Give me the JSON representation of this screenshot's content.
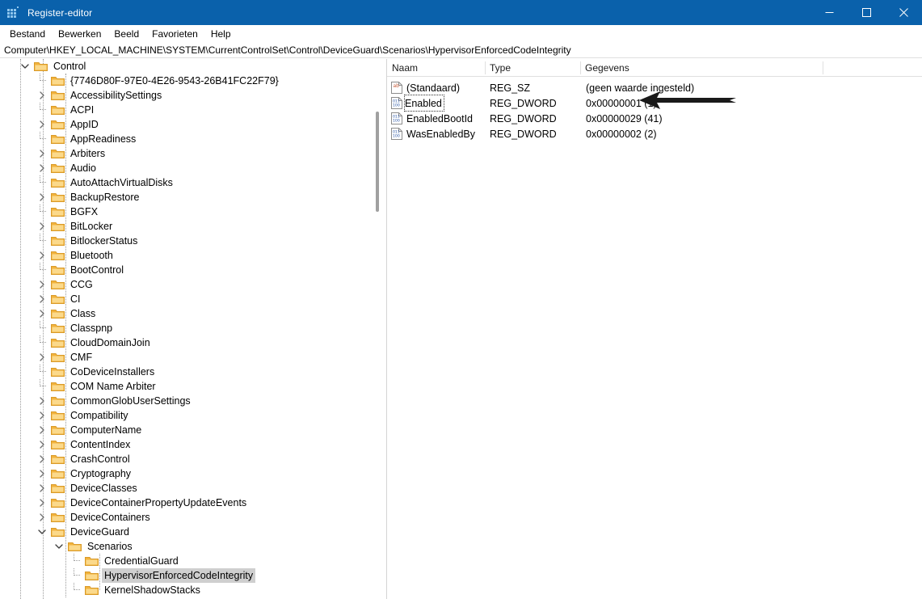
{
  "window": {
    "title": "Register-editor",
    "icon": "regedit-icon",
    "minimize_label": "─",
    "maximize_label": "□",
    "close_label": "✕"
  },
  "menubar": {
    "items": [
      {
        "label": "Bestand",
        "name": "menu-bestand"
      },
      {
        "label": "Bewerken",
        "name": "menu-bewerken"
      },
      {
        "label": "Beeld",
        "name": "menu-beeld"
      },
      {
        "label": "Favorieten",
        "name": "menu-favorieten"
      },
      {
        "label": "Help",
        "name": "menu-help"
      }
    ]
  },
  "address": {
    "path": "Computer\\HKEY_LOCAL_MACHINE\\SYSTEM\\CurrentControlSet\\Control\\DeviceGuard\\Scenarios\\HypervisorEnforcedCodeIntegrity"
  },
  "tree": {
    "nodes": [
      {
        "label": "Control",
        "depth": 2,
        "state": "expanded",
        "selected": false
      },
      {
        "label": "{7746D80F-97E0-4E26-9543-26B41FC22F79}",
        "depth": 3,
        "state": "leaf",
        "selected": false
      },
      {
        "label": "AccessibilitySettings",
        "depth": 3,
        "state": "collapsed",
        "selected": false
      },
      {
        "label": "ACPI",
        "depth": 3,
        "state": "leaf",
        "selected": false
      },
      {
        "label": "AppID",
        "depth": 3,
        "state": "collapsed",
        "selected": false
      },
      {
        "label": "AppReadiness",
        "depth": 3,
        "state": "leaf",
        "selected": false
      },
      {
        "label": "Arbiters",
        "depth": 3,
        "state": "collapsed",
        "selected": false
      },
      {
        "label": "Audio",
        "depth": 3,
        "state": "collapsed",
        "selected": false
      },
      {
        "label": "AutoAttachVirtualDisks",
        "depth": 3,
        "state": "leaf",
        "selected": false
      },
      {
        "label": "BackupRestore",
        "depth": 3,
        "state": "collapsed",
        "selected": false
      },
      {
        "label": "BGFX",
        "depth": 3,
        "state": "leaf",
        "selected": false
      },
      {
        "label": "BitLocker",
        "depth": 3,
        "state": "collapsed",
        "selected": false
      },
      {
        "label": "BitlockerStatus",
        "depth": 3,
        "state": "leaf",
        "selected": false
      },
      {
        "label": "Bluetooth",
        "depth": 3,
        "state": "collapsed",
        "selected": false
      },
      {
        "label": "BootControl",
        "depth": 3,
        "state": "leaf",
        "selected": false
      },
      {
        "label": "CCG",
        "depth": 3,
        "state": "collapsed",
        "selected": false
      },
      {
        "label": "CI",
        "depth": 3,
        "state": "collapsed",
        "selected": false
      },
      {
        "label": "Class",
        "depth": 3,
        "state": "collapsed",
        "selected": false
      },
      {
        "label": "Classpnp",
        "depth": 3,
        "state": "leaf",
        "selected": false
      },
      {
        "label": "CloudDomainJoin",
        "depth": 3,
        "state": "leaf",
        "selected": false
      },
      {
        "label": "CMF",
        "depth": 3,
        "state": "collapsed",
        "selected": false
      },
      {
        "label": "CoDeviceInstallers",
        "depth": 3,
        "state": "leaf",
        "selected": false
      },
      {
        "label": "COM Name Arbiter",
        "depth": 3,
        "state": "leaf",
        "selected": false
      },
      {
        "label": "CommonGlobUserSettings",
        "depth": 3,
        "state": "collapsed",
        "selected": false
      },
      {
        "label": "Compatibility",
        "depth": 3,
        "state": "collapsed",
        "selected": false
      },
      {
        "label": "ComputerName",
        "depth": 3,
        "state": "collapsed",
        "selected": false
      },
      {
        "label": "ContentIndex",
        "depth": 3,
        "state": "collapsed",
        "selected": false
      },
      {
        "label": "CrashControl",
        "depth": 3,
        "state": "collapsed",
        "selected": false
      },
      {
        "label": "Cryptography",
        "depth": 3,
        "state": "collapsed",
        "selected": false
      },
      {
        "label": "DeviceClasses",
        "depth": 3,
        "state": "collapsed",
        "selected": false
      },
      {
        "label": "DeviceContainerPropertyUpdateEvents",
        "depth": 3,
        "state": "collapsed",
        "selected": false
      },
      {
        "label": "DeviceContainers",
        "depth": 3,
        "state": "collapsed",
        "selected": false
      },
      {
        "label": "DeviceGuard",
        "depth": 3,
        "state": "expanded",
        "selected": false
      },
      {
        "label": "Scenarios",
        "depth": 4,
        "state": "expanded",
        "selected": false
      },
      {
        "label": "CredentialGuard",
        "depth": 5,
        "state": "leaf",
        "selected": false
      },
      {
        "label": "HypervisorEnforcedCodeIntegrity",
        "depth": 5,
        "state": "leaf",
        "selected": true
      },
      {
        "label": "KernelShadowStacks",
        "depth": 5,
        "state": "leaf",
        "selected": false
      }
    ]
  },
  "list": {
    "columns": [
      {
        "label": "Naam",
        "name": "column-naam"
      },
      {
        "label": "Type",
        "name": "column-type"
      },
      {
        "label": "Gegevens",
        "name": "column-gegevens"
      }
    ],
    "rows": [
      {
        "name": "(Standaard)",
        "type": "REG_SZ",
        "data": "(geen waarde ingesteld)",
        "icon": "string-value-icon",
        "focused": false
      },
      {
        "name": "Enabled",
        "type": "REG_DWORD",
        "data": "0x00000001 (1)",
        "icon": "dword-value-icon",
        "focused": true
      },
      {
        "name": "EnabledBootId",
        "type": "REG_DWORD",
        "data": "0x00000029 (41)",
        "icon": "dword-value-icon",
        "focused": false
      },
      {
        "name": "WasEnabledBy",
        "type": "REG_DWORD",
        "data": "0x00000002 (2)",
        "icon": "dword-value-icon",
        "focused": false
      }
    ]
  },
  "annotation": {
    "arrow": "left-pointing-arrow",
    "points_to": "Enabled"
  },
  "colors": {
    "titlebar": "#0a61ab",
    "folder": "#f8c968",
    "selection": "#cfcfcf",
    "string_icon": "#c75b39",
    "dword_icon": "#2b57a8"
  }
}
